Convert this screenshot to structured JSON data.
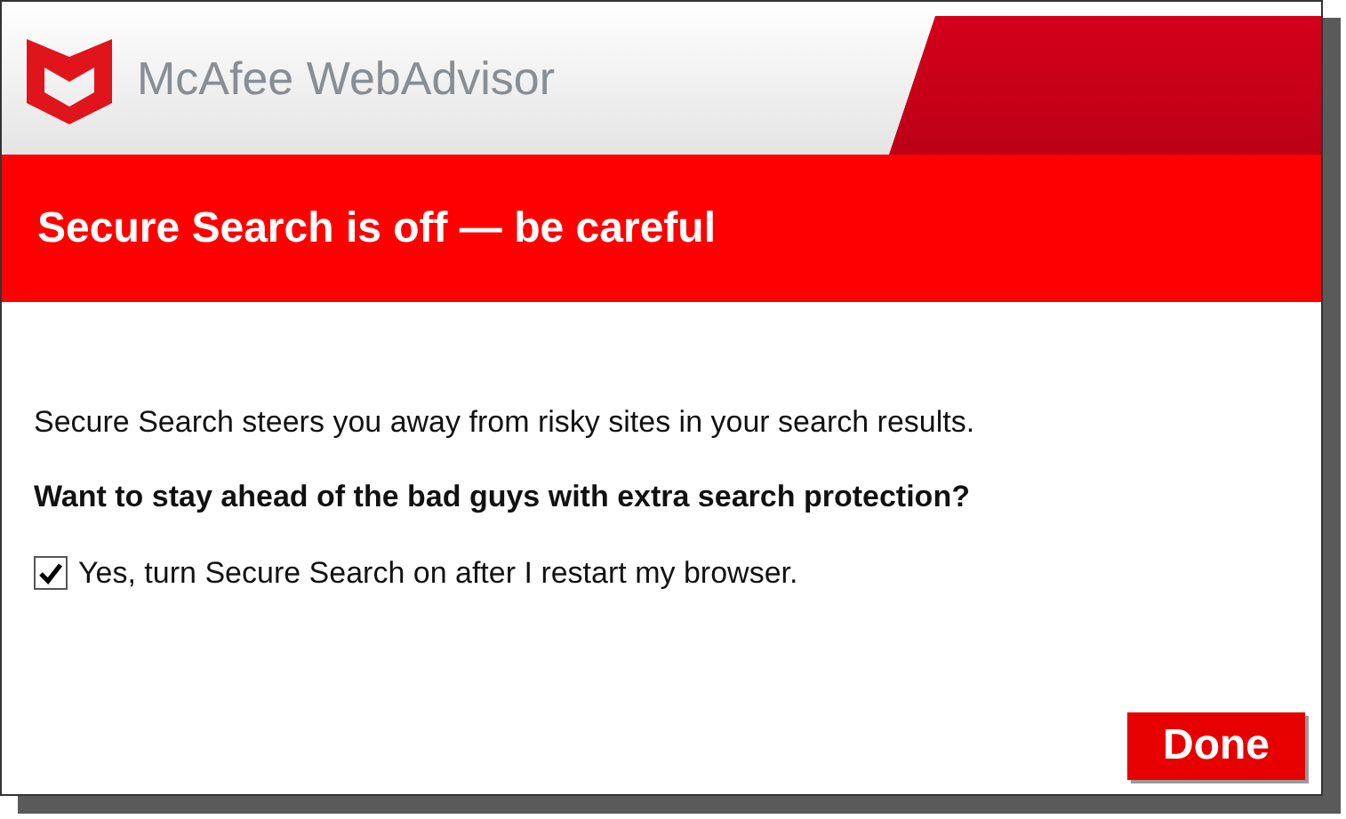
{
  "window": {
    "title": "McAfee WebAdvisor"
  },
  "banner": {
    "title": "Secure Search is off — be careful"
  },
  "message": "Secure Search steers you away from risky sites in your search results.",
  "question": "Want to stay ahead of the bad guys with extra search protection?",
  "option": {
    "label": "Yes, turn Secure Search on after I restart my browser.",
    "checked": true
  },
  "buttons": [
    "Done"
  ]
}
